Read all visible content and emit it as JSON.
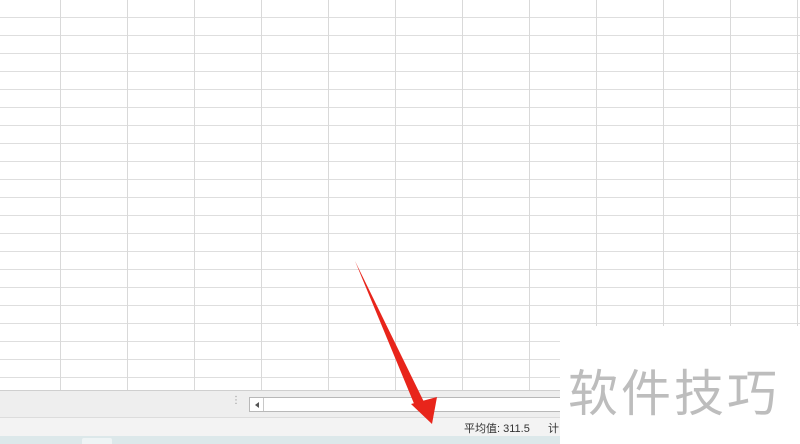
{
  "status_bar": {
    "average": "平均值: 311.5",
    "count": "计"
  },
  "watermark": {
    "text": "软件技巧"
  },
  "colors": {
    "annotation_arrow": "#e8251b",
    "gridline": "#d9d9d9",
    "status_background": "#f3f3f3"
  }
}
